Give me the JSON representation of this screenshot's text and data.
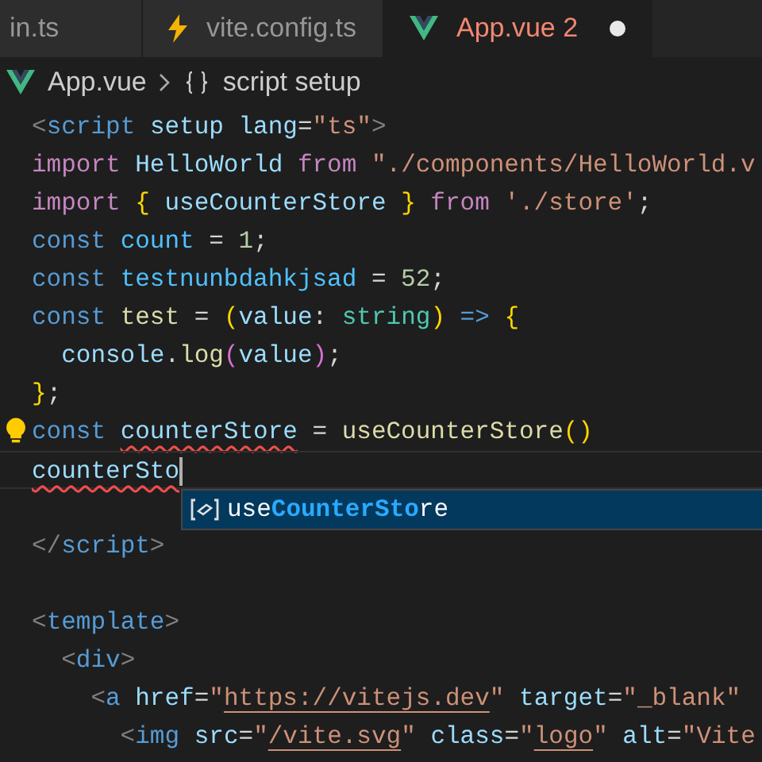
{
  "tabs": [
    {
      "label": "in.ts",
      "selected": false,
      "modified": false
    },
    {
      "label": "vite.config.ts",
      "kind": "vite",
      "selected": false,
      "modified": false
    },
    {
      "label": "App.vue",
      "kind": "vue",
      "problems": "2",
      "selected": true,
      "modified": true
    }
  ],
  "breadcrumb": [
    {
      "label": "App.vue",
      "kind": "vue"
    },
    {
      "label": "script setup",
      "kind": "braces"
    }
  ],
  "editor": {
    "lines": [
      {
        "active": false,
        "lightbulb": false,
        "tokens": [
          {
            "kind": "punct",
            "text": "<"
          },
          {
            "kind": "tag",
            "text": "script "
          },
          {
            "kind": "attr",
            "text": "setup "
          },
          {
            "kind": "attr",
            "text": "lang"
          },
          {
            "kind": "plain",
            "text": "="
          },
          {
            "kind": "str",
            "text": "\"ts\""
          },
          {
            "kind": "punct",
            "text": ">"
          }
        ]
      },
      {
        "active": false,
        "lightbulb": false,
        "tokens": [
          {
            "kind": "kw",
            "text": "import "
          },
          {
            "kind": "var",
            "text": "HelloWorld "
          },
          {
            "kind": "kw",
            "text": "from "
          },
          {
            "kind": "str",
            "text": "\"./components/HelloWorld.v"
          }
        ]
      },
      {
        "active": false,
        "lightbulb": false,
        "tokens": [
          {
            "kind": "kw",
            "text": "import "
          },
          {
            "kind": "bracket",
            "text": "{ "
          },
          {
            "kind": "var",
            "text": "useCounterStore "
          },
          {
            "kind": "bracket",
            "text": "} "
          },
          {
            "kind": "kw",
            "text": "from "
          },
          {
            "kind": "str",
            "text": "'./store'"
          },
          {
            "kind": "plain",
            "text": ";"
          }
        ]
      },
      {
        "active": false,
        "lightbulb": false,
        "tokens": [
          {
            "kind": "storage",
            "text": "const "
          },
          {
            "kind": "const",
            "text": "count"
          },
          {
            "kind": "plain",
            "text": " = "
          },
          {
            "kind": "num",
            "text": "1"
          },
          {
            "kind": "plain",
            "text": ";"
          }
        ]
      },
      {
        "active": false,
        "lightbulb": false,
        "tokens": [
          {
            "kind": "storage",
            "text": "const "
          },
          {
            "kind": "const",
            "text": "testnunbdahkjsad"
          },
          {
            "kind": "plain",
            "text": " = "
          },
          {
            "kind": "num",
            "text": "52"
          },
          {
            "kind": "plain",
            "text": ";"
          }
        ]
      },
      {
        "active": false,
        "lightbulb": false,
        "tokens": [
          {
            "kind": "storage",
            "text": "const "
          },
          {
            "kind": "func",
            "text": "test"
          },
          {
            "kind": "plain",
            "text": " = "
          },
          {
            "kind": "bracket",
            "text": "("
          },
          {
            "kind": "var",
            "text": "value"
          },
          {
            "kind": "plain",
            "text": ": "
          },
          {
            "kind": "type",
            "text": "string"
          },
          {
            "kind": "bracket",
            "text": ")"
          },
          {
            "kind": "storage",
            "text": " => "
          },
          {
            "kind": "bracket",
            "text": "{"
          }
        ]
      },
      {
        "active": false,
        "lightbulb": false,
        "tokens": [
          {
            "kind": "var",
            "text": "  console"
          },
          {
            "kind": "plain",
            "text": "."
          },
          {
            "kind": "func",
            "text": "log"
          },
          {
            "kind": "bracket2",
            "text": "("
          },
          {
            "kind": "var",
            "text": "value"
          },
          {
            "kind": "bracket2",
            "text": ")"
          },
          {
            "kind": "plain",
            "text": ";"
          }
        ]
      },
      {
        "active": false,
        "lightbulb": false,
        "tokens": [
          {
            "kind": "bracket",
            "text": "}"
          },
          {
            "kind": "plain",
            "text": ";"
          }
        ]
      },
      {
        "active": false,
        "lightbulb": true,
        "tokens": [
          {
            "kind": "storage",
            "text": "const "
          },
          {
            "kind": "error",
            "text": "counterStore"
          },
          {
            "kind": "plain",
            "text": " = "
          },
          {
            "kind": "func",
            "text": "useCounterStore"
          },
          {
            "kind": "bracket",
            "text": "()"
          }
        ]
      },
      {
        "active": true,
        "lightbulb": false,
        "tokens": [
          {
            "kind": "error",
            "text": "counterSto"
          }
        ]
      },
      {
        "active": false,
        "lightbulb": false
      },
      {
        "active": false,
        "lightbulb": false,
        "tokens": [
          {
            "kind": "punct",
            "text": "</"
          },
          {
            "kind": "tag",
            "text": "script"
          },
          {
            "kind": "punct",
            "text": ">"
          }
        ]
      },
      {
        "active": false,
        "lightbulb": false
      },
      {
        "active": false,
        "lightbulb": false,
        "tokens": [
          {
            "kind": "punct",
            "text": "<"
          },
          {
            "kind": "tag",
            "text": "template"
          },
          {
            "kind": "punct",
            "text": ">"
          }
        ]
      },
      {
        "active": false,
        "lightbulb": false,
        "tokens": [
          {
            "kind": "punct",
            "text": "  <"
          },
          {
            "kind": "tag",
            "text": "div"
          },
          {
            "kind": "punct",
            "text": ">"
          }
        ]
      },
      {
        "active": false,
        "lightbulb": false,
        "tokens": [
          {
            "kind": "punct",
            "text": "    <"
          },
          {
            "kind": "tag",
            "text": "a "
          },
          {
            "kind": "attr",
            "text": "href"
          },
          {
            "kind": "plain",
            "text": "="
          },
          {
            "kind": "str",
            "text": "\""
          },
          {
            "kind": "link",
            "text": "https://vitejs.dev"
          },
          {
            "kind": "str",
            "text": "\" "
          },
          {
            "kind": "attr",
            "text": "target"
          },
          {
            "kind": "plain",
            "text": "="
          },
          {
            "kind": "str",
            "text": "\"_blank\""
          }
        ]
      },
      {
        "active": false,
        "lightbulb": false,
        "tokens": [
          {
            "kind": "punct",
            "text": "      <"
          },
          {
            "kind": "tag",
            "text": "img "
          },
          {
            "kind": "attr",
            "text": "src"
          },
          {
            "kind": "plain",
            "text": "="
          },
          {
            "kind": "str",
            "text": "\""
          },
          {
            "kind": "link",
            "text": "/vite.svg"
          },
          {
            "kind": "str",
            "text": "\" "
          },
          {
            "kind": "attr",
            "text": "class"
          },
          {
            "kind": "plain",
            "text": "="
          },
          {
            "kind": "str",
            "text": "\""
          },
          {
            "kind": "link",
            "text": "logo"
          },
          {
            "kind": "str",
            "text": "\" "
          },
          {
            "kind": "attr",
            "text": "alt"
          },
          {
            "kind": "plain",
            "text": "="
          },
          {
            "kind": "str",
            "text": "\"Vite"
          }
        ]
      }
    ]
  },
  "suggestion": {
    "items": [
      {
        "kind": "variable",
        "selected": true,
        "parts": [
          {
            "text": "use",
            "match": false
          },
          {
            "text": "CounterSto",
            "match": true
          },
          {
            "text": "re",
            "match": false
          }
        ]
      }
    ]
  }
}
